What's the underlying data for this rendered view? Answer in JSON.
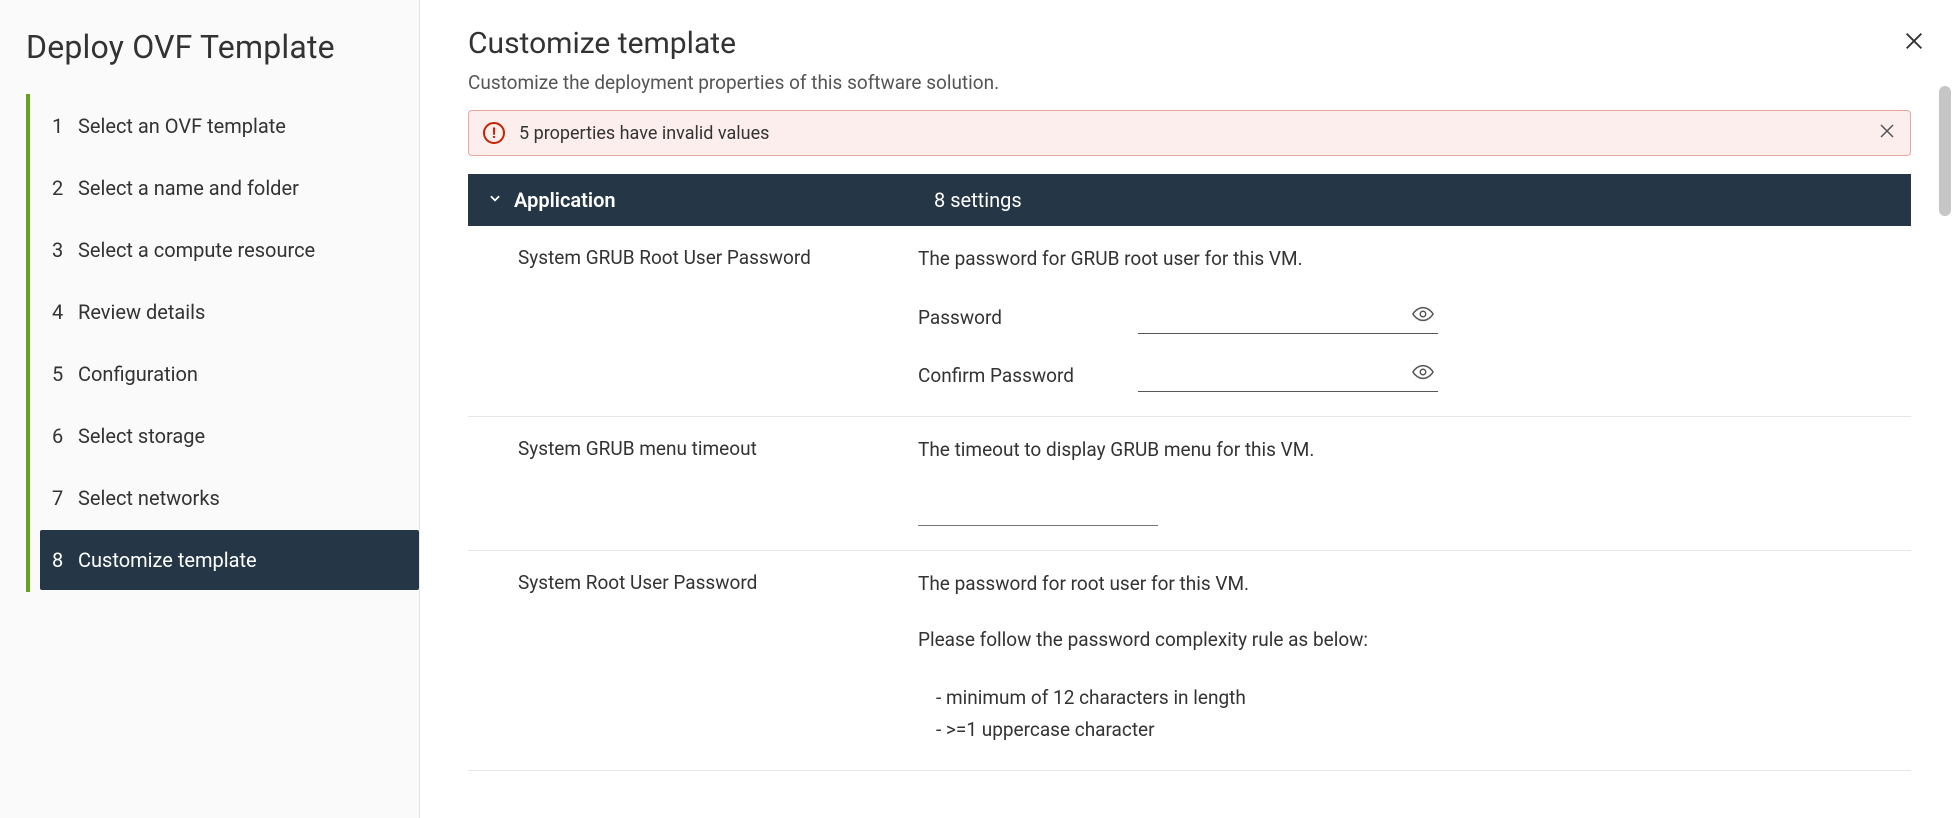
{
  "wizard": {
    "title": "Deploy OVF Template",
    "steps": [
      {
        "num": "1",
        "label": "Select an OVF template"
      },
      {
        "num": "2",
        "label": "Select a name and folder"
      },
      {
        "num": "3",
        "label": "Select a compute resource"
      },
      {
        "num": "4",
        "label": "Review details"
      },
      {
        "num": "5",
        "label": "Configuration"
      },
      {
        "num": "6",
        "label": "Select storage"
      },
      {
        "num": "7",
        "label": "Select networks"
      },
      {
        "num": "8",
        "label": "Customize template"
      }
    ],
    "active_index": 7
  },
  "page": {
    "title": "Customize template",
    "subtitle": "Customize the deployment properties of this software solution."
  },
  "alert": {
    "text": "5 properties have invalid values"
  },
  "section": {
    "title": "Application",
    "count_label": "8 settings"
  },
  "fields": {
    "grub_pw": {
      "label": "System GRUB Root User Password",
      "description": "The password for GRUB root user for this VM.",
      "password_label": "Password",
      "confirm_label": "Confirm Password",
      "password_value": "",
      "confirm_value": ""
    },
    "grub_timeout": {
      "label": "System GRUB menu timeout",
      "description": "The timeout to display GRUB menu for this VM.",
      "value": ""
    },
    "root_pw": {
      "label": "System Root User Password",
      "description_a": "The password for root user for this VM.",
      "description_b": "Please follow the password complexity rule as below:",
      "rule1": "minimum of 12 characters in length",
      "rule2": ">=1 uppercase character"
    }
  }
}
